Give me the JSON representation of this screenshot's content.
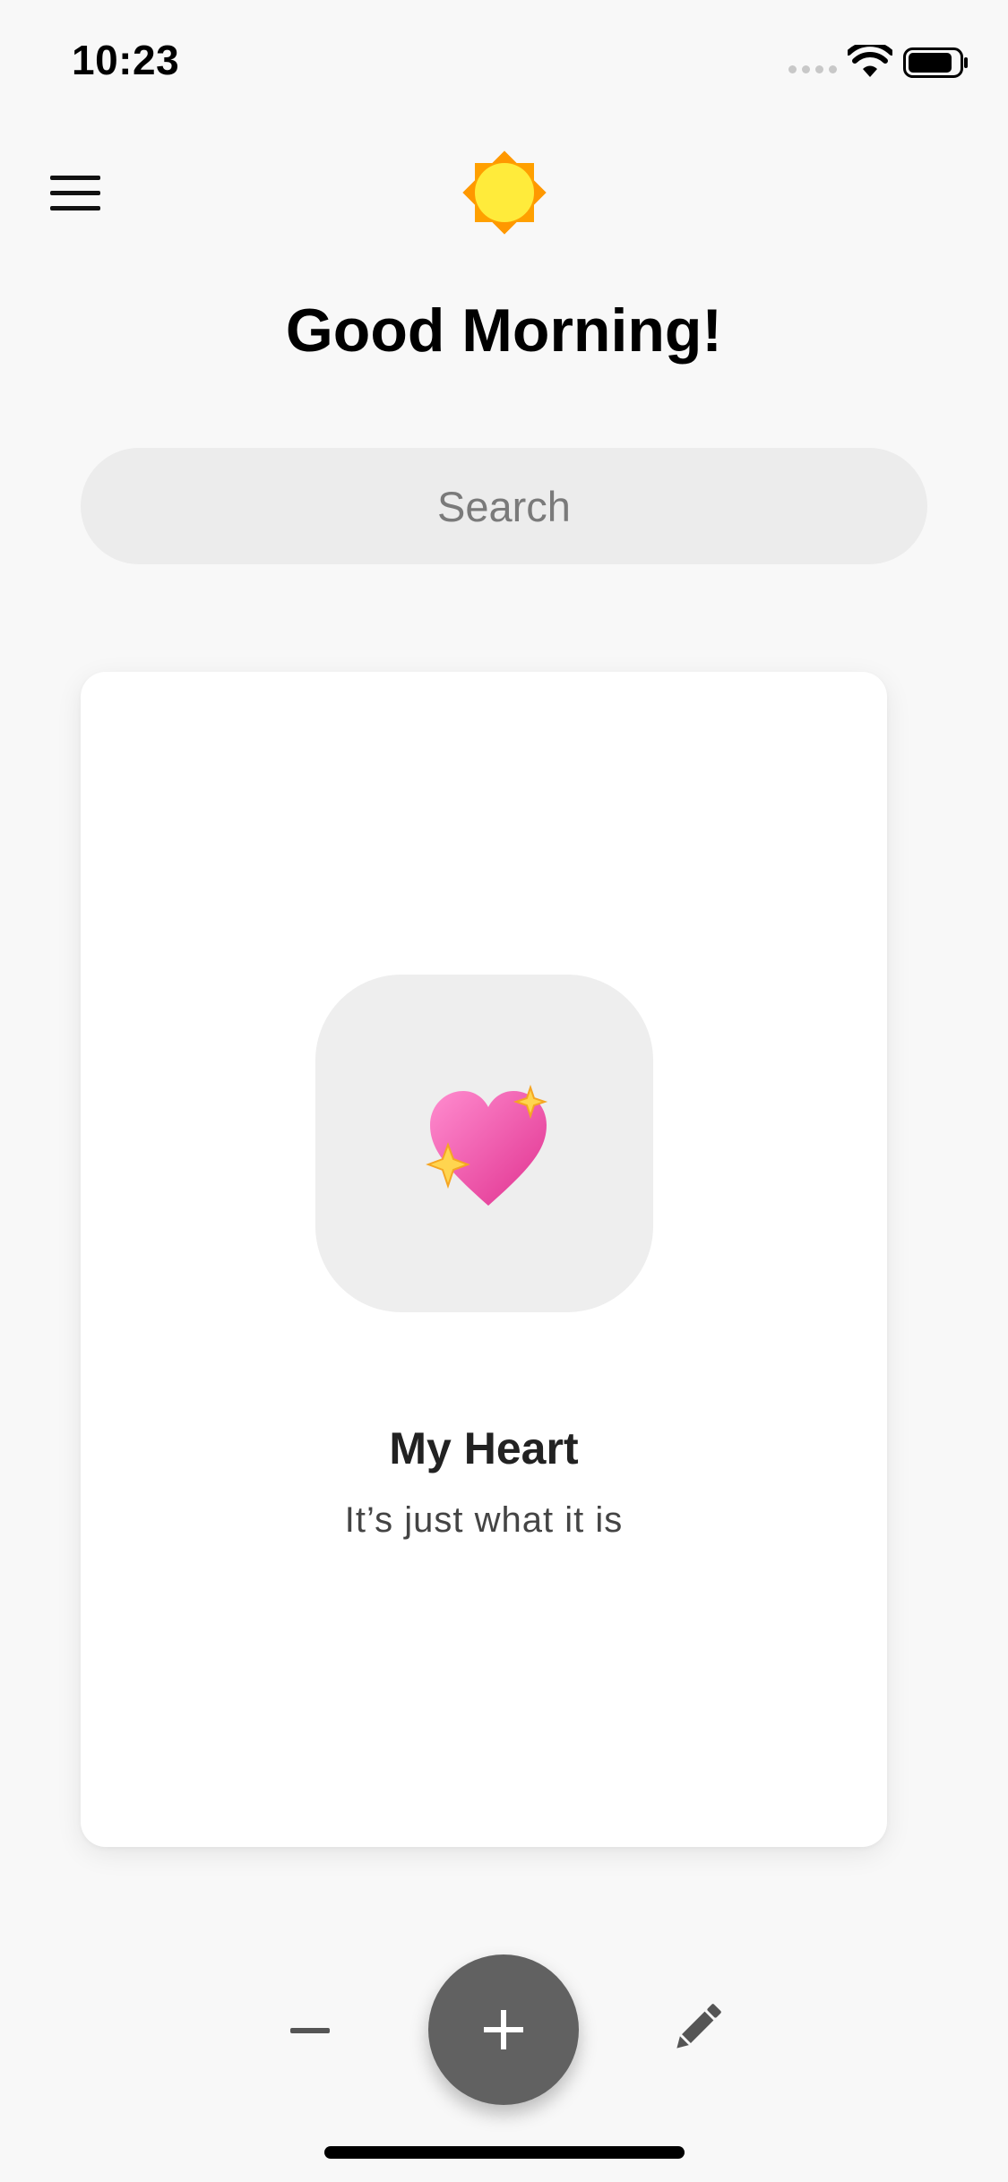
{
  "status_bar": {
    "time": "10:23",
    "icons": [
      "signal-dots-icon",
      "wifi-icon",
      "battery-icon"
    ]
  },
  "header": {
    "menu_icon": "hamburger-menu-icon",
    "weather_icon": "sun-icon",
    "greeting": "Good Morning!"
  },
  "search": {
    "placeholder": "Search",
    "value": ""
  },
  "card": {
    "emoji_icon": "sparkling-heart-icon",
    "title": "My Heart",
    "subtitle": "It’s just what it is"
  },
  "controls": {
    "decrement_icon": "minus-icon",
    "add_icon": "plus-icon",
    "edit_icon": "pencil-icon"
  },
  "colors": {
    "background": "#f8f8f8",
    "search_background": "#ececec",
    "fab": "#616161",
    "sun": "#ffeb3b",
    "sun_rays": "#ff9800",
    "heart": "#ec4fa6"
  }
}
